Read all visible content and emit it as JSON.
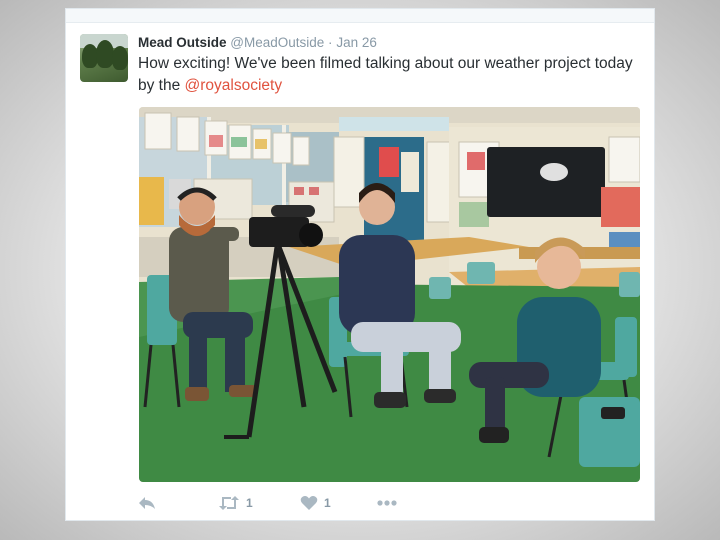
{
  "tweet": {
    "display_name": "Mead Outside",
    "handle": "@MeadOutside",
    "separator": "·",
    "date": "Jan 26",
    "text_before": "How exciting! We've been filmed talking about our weather project today by the ",
    "mention": "@royalsociety",
    "mention_color": "#e0533f"
  },
  "actions": {
    "reply_icon": "reply-icon",
    "retweet_icon": "retweet-icon",
    "retweet_count": "1",
    "like_icon": "heart-icon",
    "like_count": "1",
    "more_icon": "more-icon"
  },
  "photo": {
    "description_icon": "classroom-filming-photo"
  }
}
